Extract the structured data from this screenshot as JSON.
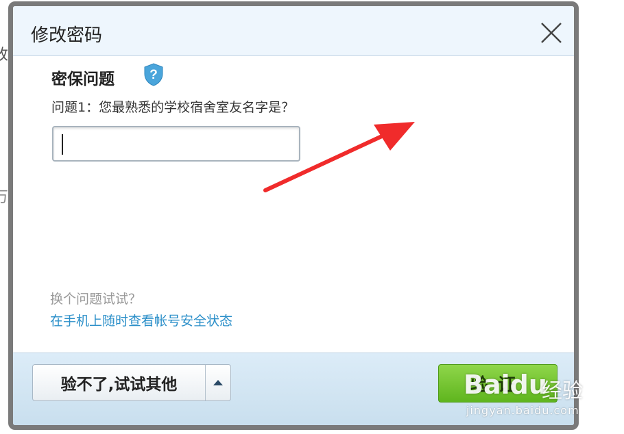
{
  "background": {
    "char_1": "改",
    "char_2": "万"
  },
  "dialog": {
    "title": "修改密码",
    "close_icon": "close-icon",
    "section_title": "密保问题",
    "section_icon": "shield-question-icon",
    "question": "问题1：您最熟悉的学校宿舍室友名字是？",
    "answer_value": "",
    "switch_question": "换个问题试试？",
    "phone_link": "在手机上随时查看帐号安全状态",
    "footer": {
      "alt_button": "验不了,试试其他",
      "alt_caret_icon": "caret-up-icon",
      "verify_button": "验证"
    }
  },
  "watermark": {
    "logo": "Baidu",
    "logo_cn": "经验",
    "url": "jingyan.baidu.com"
  },
  "colors": {
    "link": "#2b8fc9",
    "verify_green": "#6cc12a",
    "footer_blue": "#d6e8f5",
    "annotation_arrow": "#f02b2b"
  }
}
